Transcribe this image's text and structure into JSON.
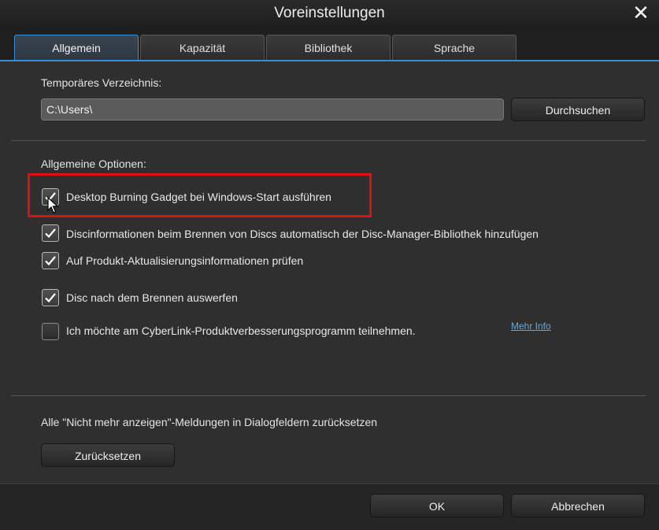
{
  "window": {
    "title": "Voreinstellungen",
    "close_glyph": "✕"
  },
  "tabs": [
    {
      "label": "Allgemein",
      "active": true
    },
    {
      "label": "Kapazität",
      "active": false
    },
    {
      "label": "Bibliothek",
      "active": false
    },
    {
      "label": "Sprache",
      "active": false
    }
  ],
  "temp_dir": {
    "label": "Temporäres Verzeichnis:",
    "value": "C:\\Users\\",
    "browse_label": "Durchsuchen"
  },
  "general": {
    "heading": "Allgemeine Optionen:",
    "options": [
      {
        "label": "Desktop Burning Gadget bei Windows-Start ausführen",
        "checked": true
      },
      {
        "label": "Discinformationen beim Brennen von Discs automatisch der Disc-Manager-Bibliothek hinzufügen",
        "checked": true
      },
      {
        "label": "Auf Produkt-Aktualisierungsinformationen prüfen",
        "checked": true
      },
      {
        "label": "Disc nach dem Brennen auswerfen",
        "checked": true
      },
      {
        "label": "Ich möchte am CyberLink-Produktverbesserungsprogramm teilnehmen.",
        "checked": false
      }
    ],
    "more_info_link": "Mehr Info"
  },
  "reset": {
    "label": "Alle \"Nicht mehr anzeigen\"-Meldungen in Dialogfeldern zurücksetzen",
    "button_label": "Zurücksetzen"
  },
  "footer": {
    "ok_label": "OK",
    "cancel_label": "Abbrechen"
  },
  "colors": {
    "accent": "#3a8fd4",
    "highlight": "#e01010",
    "link": "#6aa9d8"
  }
}
